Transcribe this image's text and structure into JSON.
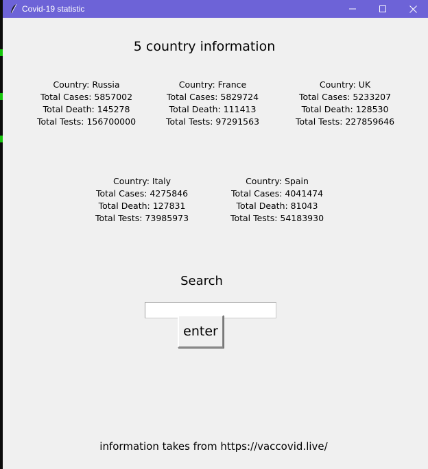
{
  "window": {
    "title": "Covid-19 statistic",
    "titlebar_color": "#6d63d7",
    "background_color": "#f0f0f0",
    "controls": {
      "minimize": "minimize-icon",
      "maximize": "maximize-icon",
      "close": "close-icon"
    }
  },
  "heading": "5 country information",
  "countries": [
    {
      "country": "Country: Russia",
      "cases": "Total Cases: 5857002",
      "deaths": "Total Death: 145278",
      "tests": "Total Tests: 156700000"
    },
    {
      "country": "Country: France",
      "cases": "Total Cases: 5829724",
      "deaths": "Total Death: 111413",
      "tests": "Total Tests: 97291563"
    },
    {
      "country": "Country: UK",
      "cases": "Total Cases: 5233207",
      "deaths": "Total Death: 128530",
      "tests": "Total Tests: 227859646"
    },
    {
      "country": "Country: Italy",
      "cases": "Total Cases: 4275846",
      "deaths": "Total Death: 127831",
      "tests": "Total Tests: 73985973"
    },
    {
      "country": "Country: Spain",
      "cases": "Total Cases: 4041474",
      "deaths": "Total Death: 81043",
      "tests": "Total Tests: 54183930"
    }
  ],
  "search": {
    "label": "Search",
    "value": "",
    "button_label": "enter"
  },
  "footer": "information takes from https://vaccovid.live/"
}
